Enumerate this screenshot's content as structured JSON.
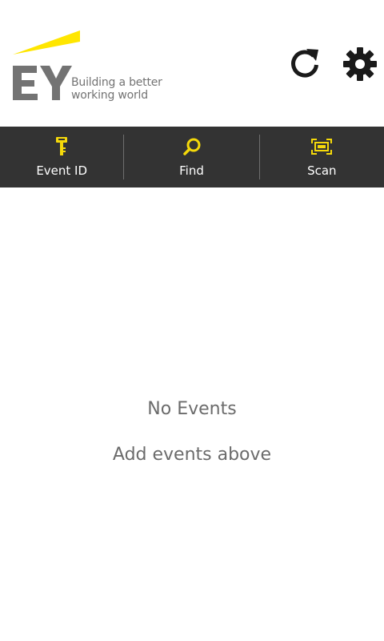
{
  "header": {
    "logo_text": "EY",
    "tagline_line1": "Building a better",
    "tagline_line2": "working world",
    "refresh_icon": "refresh-icon",
    "settings_icon": "gear-icon"
  },
  "toolbar": {
    "items": [
      {
        "label": "Event ID",
        "icon": "key-icon"
      },
      {
        "label": "Find",
        "icon": "search-icon"
      },
      {
        "label": "Scan",
        "icon": "scan-icon"
      }
    ]
  },
  "empty_state": {
    "title": "No Events",
    "subtitle": "Add events above"
  },
  "colors": {
    "brand_yellow": "#FFE600",
    "logo_gray": "#737373",
    "toolbar_bg": "#333333",
    "icon_dark": "#1a1a1a",
    "text_gray": "#6b6b6b"
  }
}
